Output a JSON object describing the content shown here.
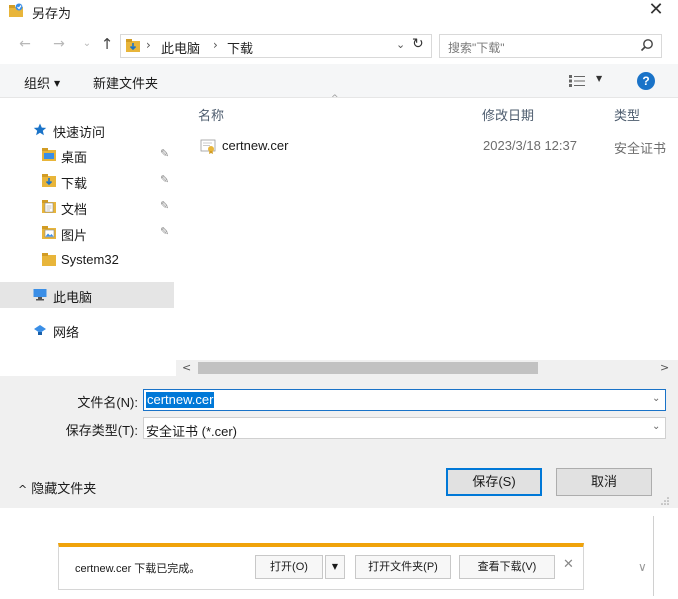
{
  "window": {
    "title": "另存为",
    "close": "✕"
  },
  "nav": {
    "back": "←",
    "forward": "→",
    "recent": "⌄",
    "up": "↑",
    "path": [
      "此电脑",
      "下载"
    ],
    "refresh": "↻",
    "dropdown": "⌄"
  },
  "search": {
    "placeholder": "搜索\"下载\""
  },
  "toolbar": {
    "organize": "组织",
    "new_folder": "新建文件夹",
    "help": "?"
  },
  "sidebar": {
    "items": [
      {
        "label": "快速访问",
        "icon": "star-icon",
        "pinned": false
      },
      {
        "label": "桌面",
        "icon": "desktop-folder-icon",
        "pinned": true
      },
      {
        "label": "下载",
        "icon": "downloads-folder-icon",
        "pinned": true
      },
      {
        "label": "文档",
        "icon": "documents-folder-icon",
        "pinned": true
      },
      {
        "label": "图片",
        "icon": "pictures-folder-icon",
        "pinned": true
      },
      {
        "label": "System32",
        "icon": "folder-icon",
        "pinned": false
      },
      {
        "label": "此电脑",
        "icon": "computer-icon",
        "pinned": false
      },
      {
        "label": "网络",
        "icon": "network-icon",
        "pinned": false
      }
    ],
    "pin_glyph": "📌"
  },
  "filelist": {
    "columns": {
      "name": "名称",
      "modified": "修改日期",
      "type": "类型"
    },
    "rows": [
      {
        "name": "certnew.cer",
        "modified": "2023/3/18 12:37",
        "type": "安全证书"
      }
    ]
  },
  "form": {
    "filename_label": "文件名(N):",
    "filename_value": "certnew.cer",
    "filetype_label": "保存类型(T):",
    "filetype_value": "安全证书 (*.cer)",
    "hide_folders": "隐藏文件夹",
    "save": "保存(S)",
    "cancel": "取消"
  },
  "download_bar": {
    "message": "certnew.cer 下载已完成。",
    "open": "打开(O)",
    "open_folder": "打开文件夹(P)",
    "view_downloads": "查看下载(V)",
    "close": "✕",
    "accent_color": "#f0a30a"
  },
  "colors": {
    "accent": "#0078d7",
    "help_blue": "#1a73c8",
    "folder_yellow": "#e8b53a"
  }
}
